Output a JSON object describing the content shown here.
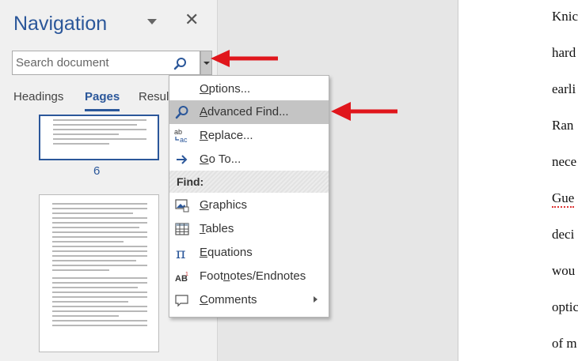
{
  "nav": {
    "title": "Navigation",
    "close": "✕",
    "search_placeholder": "Search document",
    "tabs": [
      "Headings",
      "Pages",
      "Result"
    ],
    "active_tab": "Pages",
    "page_number": "6"
  },
  "menu": {
    "items": [
      {
        "pre": "",
        "u": "O",
        "post": "ptions...",
        "icon": "none"
      },
      {
        "pre": "",
        "u": "A",
        "post": "dvanced Find...",
        "icon": "magnifier-icon"
      },
      {
        "pre": "",
        "u": "R",
        "post": "eplace...",
        "icon": "replace-icon"
      },
      {
        "pre": "",
        "u": "G",
        "post": "o To...",
        "icon": "goto-arrow-icon"
      }
    ],
    "find_header": "Find:",
    "find_items": [
      {
        "pre": "",
        "u": "G",
        "post": "raphics",
        "icon": "graphics-icon"
      },
      {
        "pre": "",
        "u": "T",
        "post": "ables",
        "icon": "table-icon"
      },
      {
        "pre": "",
        "u": "E",
        "post": "quations",
        "icon": "pi-icon"
      },
      {
        "pre": "Foot",
        "u": "n",
        "post": "otes/Endnotes",
        "icon": "footnote-icon"
      },
      {
        "pre": "",
        "u": "C",
        "post": "omments",
        "icon": "comment-icon"
      }
    ]
  },
  "document": {
    "lines": [
      "Knic",
      "hard",
      "earli",
      "Ran",
      "nece",
      "Gue",
      "deci",
      "wou",
      "optic",
      "of m"
    ]
  },
  "colors": {
    "accent": "#2b579a",
    "arrow": "#e0161c",
    "highlight": "#c4c4c4"
  }
}
